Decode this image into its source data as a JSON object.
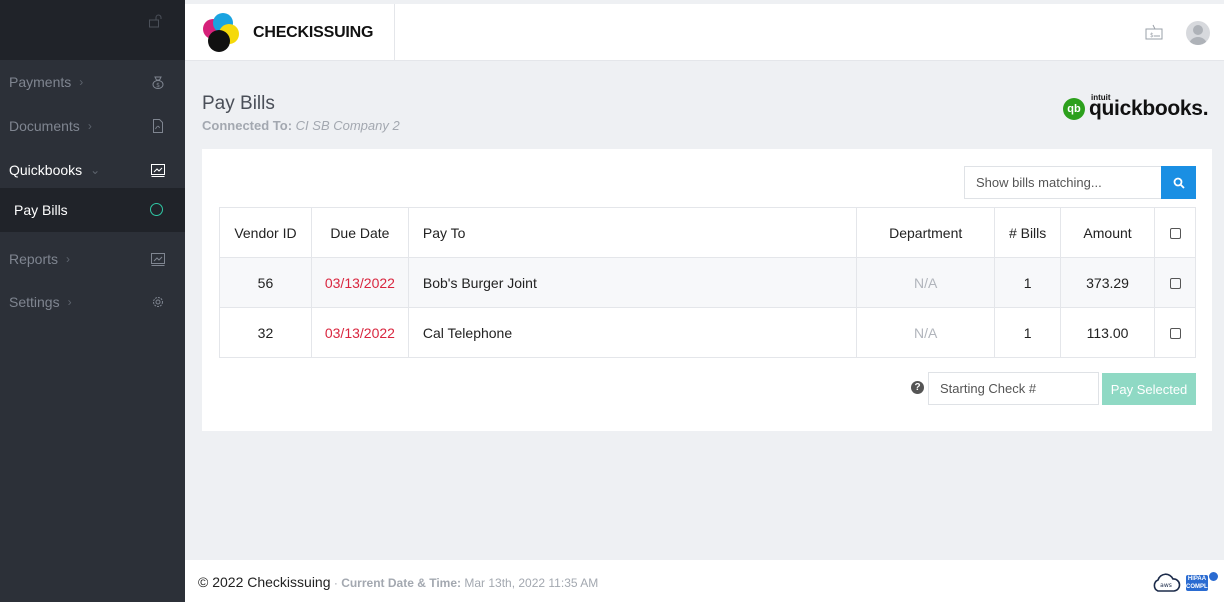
{
  "brand": {
    "name": "CHECKISSUING"
  },
  "sidebar": {
    "items": [
      {
        "label": "Payments",
        "icon": "money-bag-icon"
      },
      {
        "label": "Documents",
        "icon": "pdf-icon"
      },
      {
        "label": "Quickbooks",
        "icon": "ledger-icon"
      },
      {
        "label": "Pay Bills",
        "icon": "ring-icon"
      },
      {
        "label": "Reports",
        "icon": "report-icon"
      },
      {
        "label": "Settings",
        "icon": "gear-icon"
      }
    ]
  },
  "page": {
    "title": "Pay Bills",
    "connected_label": "Connected To:",
    "connected_value": "CI SB Company 2",
    "qb_intuit": "intuit",
    "qb_word": "quickbooks."
  },
  "search": {
    "placeholder": "Show bills matching..."
  },
  "table": {
    "headers": [
      "Vendor ID",
      "Due Date",
      "Pay To",
      "Department",
      "# Bills",
      "Amount"
    ],
    "rows": [
      {
        "vendor_id": "56",
        "due_date": "03/13/2022",
        "pay_to": "Bob's Burger Joint",
        "department": "N/A",
        "bills": "1",
        "amount": "373.29"
      },
      {
        "vendor_id": "32",
        "due_date": "03/13/2022",
        "pay_to": "Cal Telephone",
        "department": "N/A",
        "bills": "1",
        "amount": "113.00"
      }
    ]
  },
  "actions": {
    "help_glyph": "?",
    "check_placeholder": "Starting Check #",
    "pay_label": "Pay Selected"
  },
  "footer": {
    "copyright": "© 2022 Checkissuing",
    "separator": " · ",
    "datetime_label": "Current Date & Time:",
    "datetime_value": "Mar 13th, 2022 11:35 AM",
    "aws_label": "aws",
    "hipaa_label": "HIPAA COMPLIANT"
  },
  "colors": {
    "sidebar_bg": "#2c3038",
    "accent_blue": "#1a8fe3",
    "due_date_red": "#d9263f",
    "pay_button_teal": "#8fd9c4",
    "qb_green": "#2ca01c"
  }
}
